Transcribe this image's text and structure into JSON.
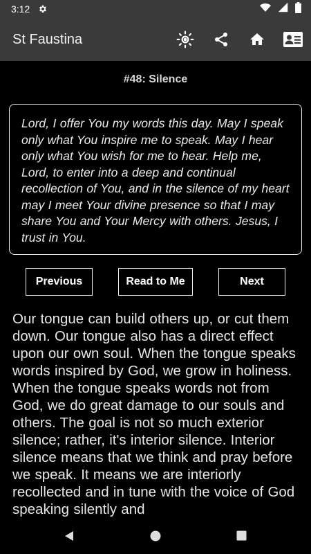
{
  "status_bar": {
    "time": "3:12",
    "icons": [
      "settings-icon",
      "wifi-icon",
      "signal-icon",
      "battery-icon"
    ]
  },
  "app_bar": {
    "title": "St Faustina",
    "actions": [
      "brightness-icon",
      "share-icon",
      "home-icon",
      "contact-card-icon"
    ]
  },
  "page": {
    "heading": "#48: Silence",
    "prayer": "Lord, I offer You my words this day.  May I speak only what You inspire me to speak.  May I hear only what You wish for me to hear.  Help me, Lord, to enter into a deep and continual recollection of You, and in the silence of my heart may I meet Your divine presence so that I may share You and Your Mercy with others.  Jesus, I trust in You.",
    "buttons": {
      "previous": "Previous",
      "read": "Read to Me",
      "next": "Next"
    },
    "body": "Our tongue can build others up, or cut them down.  Our tongue also has a direct effect upon our own soul.  When the tongue speaks words inspired by God, we grow in holiness.  When the tongue speaks words not from God, we do great damage to our souls and others.  The goal is not so much exterior silence; rather, it's interior silence.  Interior silence means that we think and pray before we speak.  It means we are interiorly recollected and in tune with the voice of God speaking silently and"
  },
  "nav_bar": {
    "buttons": [
      "back-icon",
      "home-circle-icon",
      "recents-icon"
    ]
  },
  "colors": {
    "app_bar": "#3a3a3a",
    "background": "#000000",
    "text": "#ffffff"
  }
}
